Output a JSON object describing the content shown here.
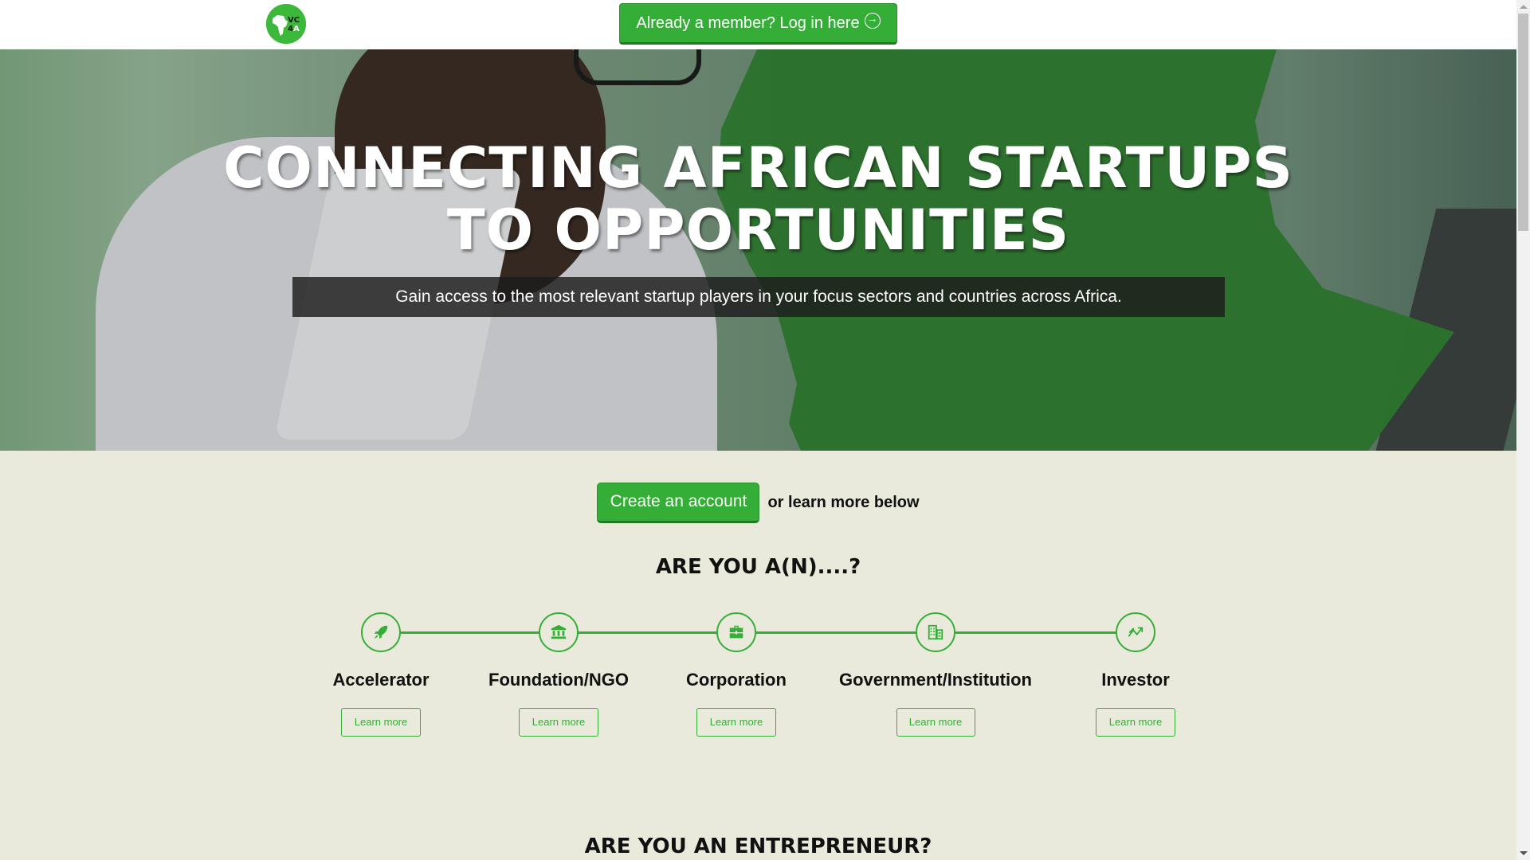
{
  "header": {
    "logo_alt": "VC4A",
    "login_button": "Already a member? Log in here",
    "login_icon": "arrow-circle-right-icon"
  },
  "hero": {
    "headline_line1": "CONNECTING AFRICAN STARTUPS",
    "headline_line2": "TO OPPORTUNITIES",
    "subtitle": "Gain access to the most relevant startup players in your focus sectors and countries across Africa."
  },
  "cta": {
    "create_button": "Create an account",
    "secondary_text": "or learn more below"
  },
  "roles_section": {
    "title": "ARE YOU A(N)....?",
    "roles": [
      {
        "label": "Accelerator",
        "icon": "rocket-icon",
        "button": "Learn more"
      },
      {
        "label": "Foundation/NGO",
        "icon": "bank-icon",
        "button": "Learn more"
      },
      {
        "label": "Corporation",
        "icon": "briefcase-icon",
        "button": "Learn more"
      },
      {
        "label": "Government/Institution",
        "icon": "building-icon",
        "button": "Learn more"
      },
      {
        "label": "Investor",
        "icon": "trend-chart-icon",
        "button": "Learn more"
      }
    ]
  },
  "entrepreneur_section": {
    "title": "ARE YOU AN ENTREPRENEUR?"
  },
  "colors": {
    "brand_green": "#35ae37",
    "hero_green": "#2f7d32",
    "background": "#e9eadb"
  }
}
